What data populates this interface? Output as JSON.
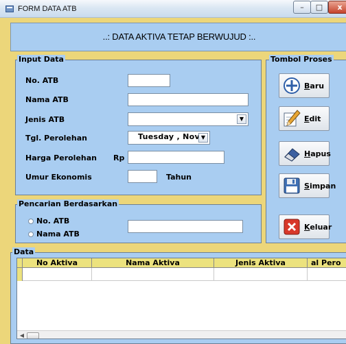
{
  "window": {
    "title": "FORM DATA ATB",
    "min": "–",
    "max": "□",
    "close": "x"
  },
  "header": {
    "title": "..: DATA AKTIVA TETAP BERWUJUD :.."
  },
  "input_data": {
    "legend": "Input Data",
    "no_atb_label": "No. ATB",
    "nama_atb_label": "Nama ATB",
    "jenis_atb_label": "Jenis ATB",
    "tgl_label": "Tgl. Perolehan",
    "tgl_value": "Tuesday   , Novemb",
    "harga_label": "Harga Perolehan",
    "rp_label": "Rp",
    "umur_label": "Umur Ekonomis",
    "tahun_label": "Tahun"
  },
  "tombol": {
    "legend": "Tombol Proses",
    "baru_key": "B",
    "baru_rest": "aru",
    "edit_key": "E",
    "edit_rest": "dit",
    "hapus_key": "H",
    "hapus_rest": "apus",
    "simpan_key": "S",
    "simpan_rest": "impan",
    "keluar_key": "K",
    "keluar_rest": "eluar"
  },
  "pencarian": {
    "legend": "Pencarian Berdasarkan",
    "opt1": "No. ATB",
    "opt2": "Nama ATB"
  },
  "data": {
    "legend": "Data",
    "columns": [
      "No Aktiva",
      "Nama Aktiva",
      "Jenis Aktiva",
      "al Pero"
    ]
  },
  "colors": {
    "panel": "#a9cdf1",
    "frame": "#ecd67a",
    "grid_header": "#ece27e"
  },
  "icons": {
    "baru": "plus-circle-icon",
    "edit": "pencil-paper-icon",
    "hapus": "eraser-icon",
    "simpan": "floppy-disk-icon",
    "keluar": "red-x-icon"
  }
}
